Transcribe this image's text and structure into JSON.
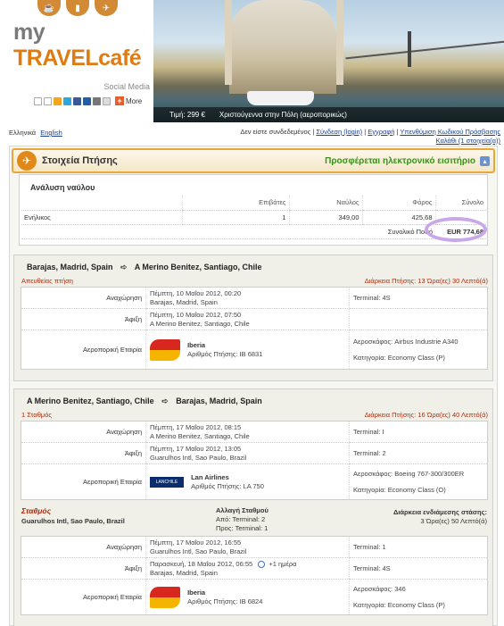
{
  "header": {
    "logo": {
      "my": "my",
      "travel": "TRAVEL",
      "cafe": "café"
    },
    "social_label": "Social Media",
    "more_label": "More",
    "photo_caption": {
      "price": "Τιμή: 299 €",
      "title": "Χριστούγεννα στην Πόλη (αεροπορικώς)"
    }
  },
  "languages": [
    "Ελληνικά",
    "English"
  ],
  "account": {
    "not_logged": "Δεν είστε συνδεδεμένος",
    "login": "Σύνδεση (login)",
    "register": "Εγγραφή",
    "password_reminder": "Υπενθύμιση Κωδικού Πρόσβασης",
    "cart": "Καλάθι (1 στοιχεία(α))"
  },
  "panel": {
    "title": "Στοιχεία Πτήσης",
    "eticket": "Προσφέρεται ηλεκτρονικό εισιτήριο",
    "collapse": "▴"
  },
  "fare": {
    "title": "Ανάλυση ναύλου",
    "headers": [
      "Επιβάτες",
      "Ναύλος",
      "Φόρος",
      "Σύνολο"
    ],
    "row": {
      "type": "Ενήλικος",
      "passengers": "1",
      "fare": "349,00",
      "tax": "425,68",
      "total": ""
    },
    "total_label": "Συνολικό Ποσό",
    "total_value": "EUR 774,68"
  },
  "flight1": {
    "from": "Barajas, Madrid, Spain",
    "to": "A Merino Benitez, Santiago, Chile",
    "type": "Απευθείας πτήση",
    "duration": "Διάρκεια Πτήσης: 13 Ώρα(ες) 30 Λεπτό(ά)",
    "departure_label": "Αναχώρηση",
    "departure_date": "Πέμπτη, 10 Μαΐου 2012, 00:20",
    "departure_place": "Barajas, Madrid, Spain",
    "departure_terminal": "Terminal: 4S",
    "arrival_label": "Άφιξη",
    "arrival_date": "Πέμπτη, 10 Μαΐου 2012, 07:50",
    "arrival_place": "A Merino Benitez, Santiago, Chile",
    "airline_label": "Αεροπορική Εταιρία",
    "airline": "Iberia",
    "flight_no": "Αριθμός Πτήσης: IB 6831",
    "aircraft": "Αεροσκάφος: Airbus Industrie A340",
    "class": "Κατηγορία: Economy Class (P)"
  },
  "flight2": {
    "from": "A Merino Benitez, Santiago, Chile",
    "to": "Barajas, Madrid, Spain",
    "type": "1 Σταθμός",
    "duration": "Διάρκεια Πτήσης: 16 Ώρα(ες) 40 Λεπτό(ά)",
    "leg1": {
      "departure_label": "Αναχώρηση",
      "departure_date": "Πέμπτη, 17 Μαΐου 2012, 08:15",
      "departure_place": "A Merino Benitez, Santiago, Chile",
      "departure_terminal": "Terminal: I",
      "arrival_label": "Άφιξη",
      "arrival_date": "Πέμπτη, 17 Μαΐου 2012, 13:05",
      "arrival_place": "Guarulhos Intl, Sao Paulo, Brazil",
      "arrival_terminal": "Terminal: 2",
      "airline_label": "Αεροπορική Εταιρία",
      "airline_logo": "LANCHILE",
      "airline": "Lan Airlines",
      "flight_no": "Αριθμός Πτήσης: LA 750",
      "aircraft": "Αεροσκάφος: Boeing 767-300/300ER",
      "class": "Κατηγορία: Economy Class (O)"
    },
    "stop": {
      "title": "Σταθμός",
      "place": "Guarulhos Intl, Sao Paulo, Brazil",
      "change": "Αλλαγή Σταθμού",
      "from_terminal": "Από: Terminal: 2",
      "to_terminal": "Προς: Terminal: 1",
      "wait_label": "Διάρκεια ενδιάμεσης στάσης:",
      "wait_value": "3 Ώρα(ες) 50 Λεπτό(ά)"
    },
    "leg2": {
      "departure_label": "Αναχώρηση",
      "departure_date": "Πέμπτη, 17 Μαΐου 2012, 16:55",
      "departure_place": "Guarulhos Intl, Sao Paulo, Brazil",
      "departure_terminal": "Terminal: 1",
      "arrival_label": "Άφιξη",
      "arrival_date": "Παρασκευή, 18 Μαΐου 2012, 06:55",
      "next_day": "+1 ημέρα",
      "arrival_place": "Barajas, Madrid, Spain",
      "arrival_terminal": "Terminal: 4S",
      "airline_label": "Αεροπορική Εταιρία",
      "airline": "Iberia",
      "flight_no": "Αριθμός Πτήσης: IB 6824",
      "aircraft": "Αεροσκάφος: 346",
      "class": "Κατηγορία: Economy Class (P)"
    }
  }
}
